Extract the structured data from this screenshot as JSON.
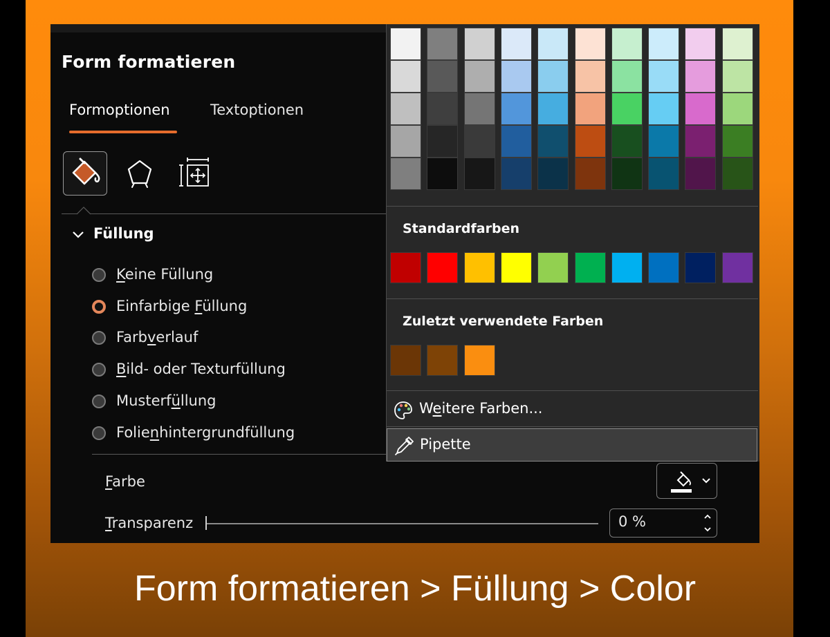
{
  "panel": {
    "title": "Form formatieren",
    "tabs": [
      {
        "label": "Formoptionen",
        "active": true
      },
      {
        "label": "Textoptionen",
        "active": false
      }
    ],
    "section": "Füllung",
    "fill_options": [
      {
        "before": "",
        "key": "K",
        "after": "eine Füllung",
        "selected": false
      },
      {
        "before": "Einfarbige ",
        "key": "F",
        "after": "üllung",
        "selected": true
      },
      {
        "before": "Farb",
        "key": "v",
        "after": "erlauf",
        "selected": false
      },
      {
        "before": "",
        "key": "B",
        "after": "ild- oder Texturfüllung",
        "selected": false
      },
      {
        "before": "Musterf",
        "key": "ü",
        "after": "llung",
        "selected": false
      },
      {
        "before": "Folie",
        "key": "n",
        "after": "hintergrundfüllung",
        "selected": false
      }
    ],
    "color_label": {
      "key": "F",
      "rest": "arbe"
    },
    "transparency_label": {
      "key": "T",
      "rest": "ransparenz"
    },
    "transparency_value": "0 %"
  },
  "picker": {
    "theme_columns": [
      [
        "#f2f2f2",
        "#d9d9d9",
        "#bfbfbf",
        "#a6a6a6",
        "#7f7f7f"
      ],
      [
        "#7f7f7f",
        "#595959",
        "#3f3f3f",
        "#262626",
        "#0d0d0d"
      ],
      [
        "#d0d0d0",
        "#aeaeae",
        "#757575",
        "#3a3a3a",
        "#171717"
      ],
      [
        "#dbe9f9",
        "#a9c9f0",
        "#5296db",
        "#215e9e",
        "#163f6b"
      ],
      [
        "#c9e8f8",
        "#8acdee",
        "#46ade0",
        "#104f6e",
        "#0b3249"
      ],
      [
        "#fde2d4",
        "#f7c3a6",
        "#f2a37d",
        "#bd4d12",
        "#7e340d"
      ],
      [
        "#c6efcf",
        "#8be2a1",
        "#49d263",
        "#184f1f",
        "#103414"
      ],
      [
        "#ccecfb",
        "#99dcf7",
        "#66cdf3",
        "#0b79a9",
        "#085371"
      ],
      [
        "#f2cdee",
        "#e59cdd",
        "#d86acc",
        "#7b2070",
        "#51154b"
      ],
      [
        "#def1d0",
        "#bde4a4",
        "#9cd77c",
        "#3b7e23",
        "#285418"
      ]
    ],
    "standard_title": "Standardfarben",
    "standard_colors": [
      "#c00000",
      "#ff0000",
      "#ffc000",
      "#ffff00",
      "#92d050",
      "#00b050",
      "#00b0f0",
      "#0070c0",
      "#002060",
      "#7030a0"
    ],
    "recent_title": "Zuletzt verwendete Farben",
    "recent_colors": [
      "#6b3606",
      "#7e4306",
      "#fa8e10"
    ],
    "more_colors": {
      "before": "W",
      "key": "e",
      "after": "itere Farben..."
    },
    "eyedropper": "Pipette"
  },
  "caption": "Form formatieren > Füllung > Color",
  "accent": "#e66c2c"
}
